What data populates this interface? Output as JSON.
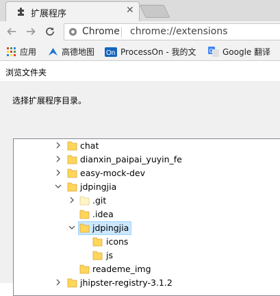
{
  "browser": {
    "tab_title": "扩展程序",
    "tab_close_glyph": "✕",
    "omnibox_chip": "Chrome",
    "omnibox_url": "chrome://extensions",
    "bookmarks": [
      {
        "label": "应用",
        "icon": "apps-grid-icon"
      },
      {
        "label": "高德地图",
        "icon": "amap-icon"
      },
      {
        "label": "ProcessOn - 我的文",
        "icon": "processon-icon"
      },
      {
        "label": "Google 翻译",
        "icon": "google-translate-icon"
      }
    ]
  },
  "dialog": {
    "title": "浏览文件夹",
    "instruction": "选择扩展程序目录。",
    "tree": [
      {
        "label": "chat",
        "expanded": false,
        "has_children": true,
        "selected": false
      },
      {
        "label": "dianxin_paipai_yuyin_fe",
        "expanded": false,
        "has_children": true,
        "selected": false
      },
      {
        "label": "easy-mock-dev",
        "expanded": false,
        "has_children": true,
        "selected": false
      },
      {
        "label": "jdpingjia",
        "expanded": true,
        "has_children": true,
        "selected": false
      },
      {
        "label": ".git",
        "expanded": false,
        "has_children": true,
        "selected": false
      },
      {
        "label": ".idea",
        "expanded": false,
        "has_children": false,
        "selected": false
      },
      {
        "label": "jdpingjia",
        "expanded": true,
        "has_children": true,
        "selected": true
      },
      {
        "label": "icons",
        "expanded": false,
        "has_children": false,
        "selected": false
      },
      {
        "label": "js",
        "expanded": false,
        "has_children": false,
        "selected": false
      },
      {
        "label": "reademe_img",
        "expanded": false,
        "has_children": false,
        "selected": false
      },
      {
        "label": "jhipster-registry-3.1.2",
        "expanded": false,
        "has_children": true,
        "selected": false
      }
    ]
  }
}
